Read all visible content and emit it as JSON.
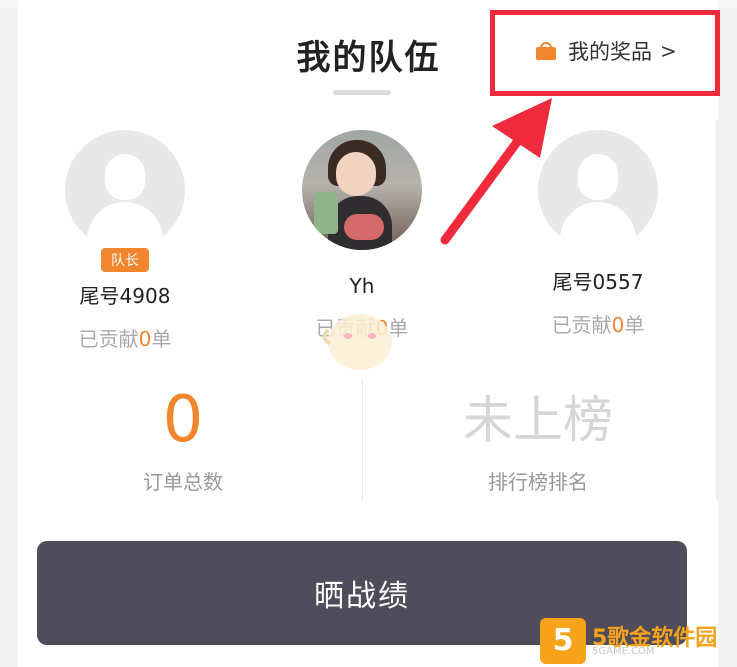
{
  "header": {
    "title": "我的队伍"
  },
  "prize_link": {
    "label": "我的奖品",
    "chevron": ">",
    "icon": "gift-icon",
    "color": "#f2862e"
  },
  "members": [
    {
      "name": "尾号4908",
      "badge": "队长",
      "contrib_prefix": "已贡献",
      "contrib_count": "0",
      "contrib_suffix": "单",
      "avatar": "default-avatar-icon"
    },
    {
      "name": "Yh",
      "contrib_prefix": "已贡献",
      "contrib_count": "0",
      "contrib_suffix": "单",
      "avatar": "user-photo"
    },
    {
      "name": "尾号0557",
      "contrib_prefix": "已贡献",
      "contrib_count": "0",
      "contrib_suffix": "单",
      "avatar": "default-avatar-icon"
    }
  ],
  "stats": [
    {
      "value": "0",
      "label": "订单总数",
      "color": "#f2862e"
    },
    {
      "value": "未上榜",
      "label": "排行榜排名",
      "color": "#d6d6d6"
    }
  ],
  "share_button": {
    "label": "晒战绩",
    "color": "#4f4d5b"
  },
  "watermark": {
    "logo": "5",
    "text": "5歌金软件园",
    "sub": "5GAME.COM"
  },
  "annotation": {
    "color": "#ee2a3c"
  }
}
